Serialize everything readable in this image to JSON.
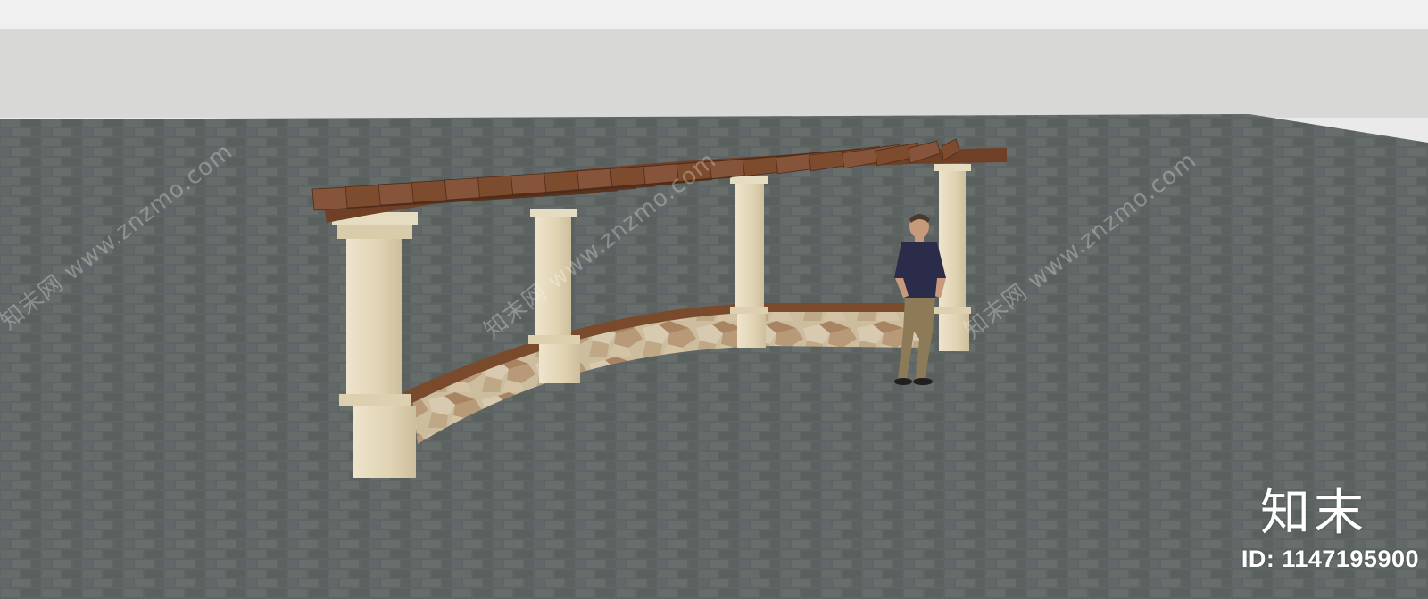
{
  "watermark": {
    "repeat_text": "知末网 www.znzmo.com",
    "brand": "知末",
    "id_text": "ID: 1147195900"
  },
  "colors": {
    "sky": "#eaeaea",
    "horizon_band": "#d6d6d4",
    "paving": "#5d6361",
    "timber": "#7b4a2e",
    "column_stone": "#e2d6b8",
    "wall_stone": "#c9b89a",
    "person_shirt": "#2b2c4a",
    "person_trousers": "#8d7b57"
  },
  "scene": {
    "subject": "pergola-3d-model",
    "objects": [
      "curved-timber-pergola",
      "stone-columns",
      "curved-stone-seat-wall",
      "paving-ground",
      "standing-person"
    ]
  }
}
